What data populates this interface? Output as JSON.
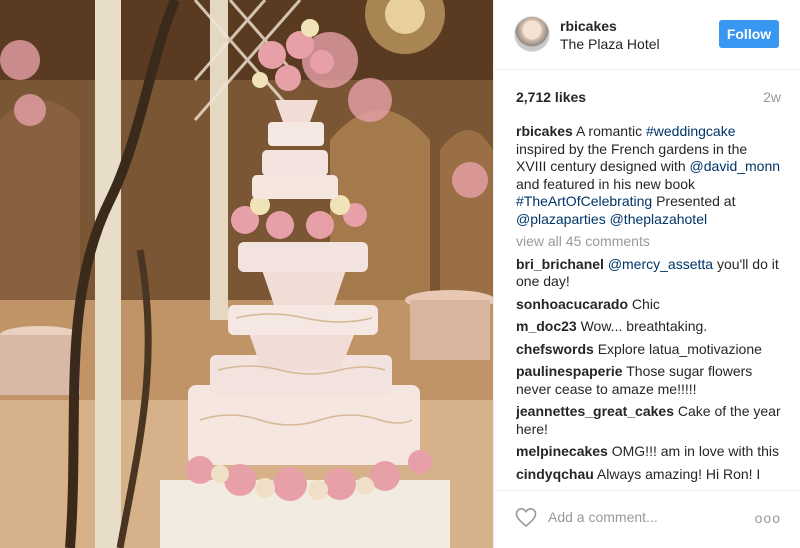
{
  "post": {
    "username": "rbicakes",
    "location": "The Plaza Hotel",
    "follow_label": "Follow",
    "likes": "2,712 likes",
    "time_ago": "2w",
    "caption": {
      "user": "rbicakes",
      "t1": " A romantic ",
      "tag1": "#weddingcake",
      "t2": " inspired by the French gardens in the XVIII century designed with ",
      "tag2": "@david_monn",
      "t3": " and featured in his new book ",
      "tag3": "#TheArtOfCelebrating",
      "t4": " Presented at ",
      "tag4": "@plazaparties",
      "t5": " ",
      "tag5": "@theplazahotel"
    },
    "view_all": "view all 45 comments",
    "comments": [
      {
        "user": "bri_brichanel",
        "mention": "@mercy_assetta",
        "text": " you'll do it one day!"
      },
      {
        "user": "sonhoacucarado",
        "mention": "",
        "text": " Chic"
      },
      {
        "user": "m_doc23",
        "mention": "",
        "text": " Wow... breathtaking."
      },
      {
        "user": "chefswords",
        "mention": "",
        "text": " Explore latua_motivazione"
      },
      {
        "user": "paulinespaperie",
        "mention": "",
        "text": " Those sugar flowers never cease to amaze me!!!!!"
      },
      {
        "user": "jeannettes_great_cakes",
        "mention": "",
        "text": " Cake of the year here!"
      },
      {
        "user": "melpinecakes",
        "mention": "",
        "text": " OMG!!! am in love with this"
      },
      {
        "user": "cindyqchau",
        "mention": "",
        "text": " Always amazing! Hi Ron! I miss you!"
      }
    ],
    "add_comment_placeholder": "Add a comment...",
    "more_label": "ooo"
  },
  "icons": {
    "like": "heart-outline-icon",
    "more": "more-options-icon"
  },
  "colors": {
    "follow_bg": "#3897f0",
    "link": "#003569",
    "muted": "#999999"
  }
}
